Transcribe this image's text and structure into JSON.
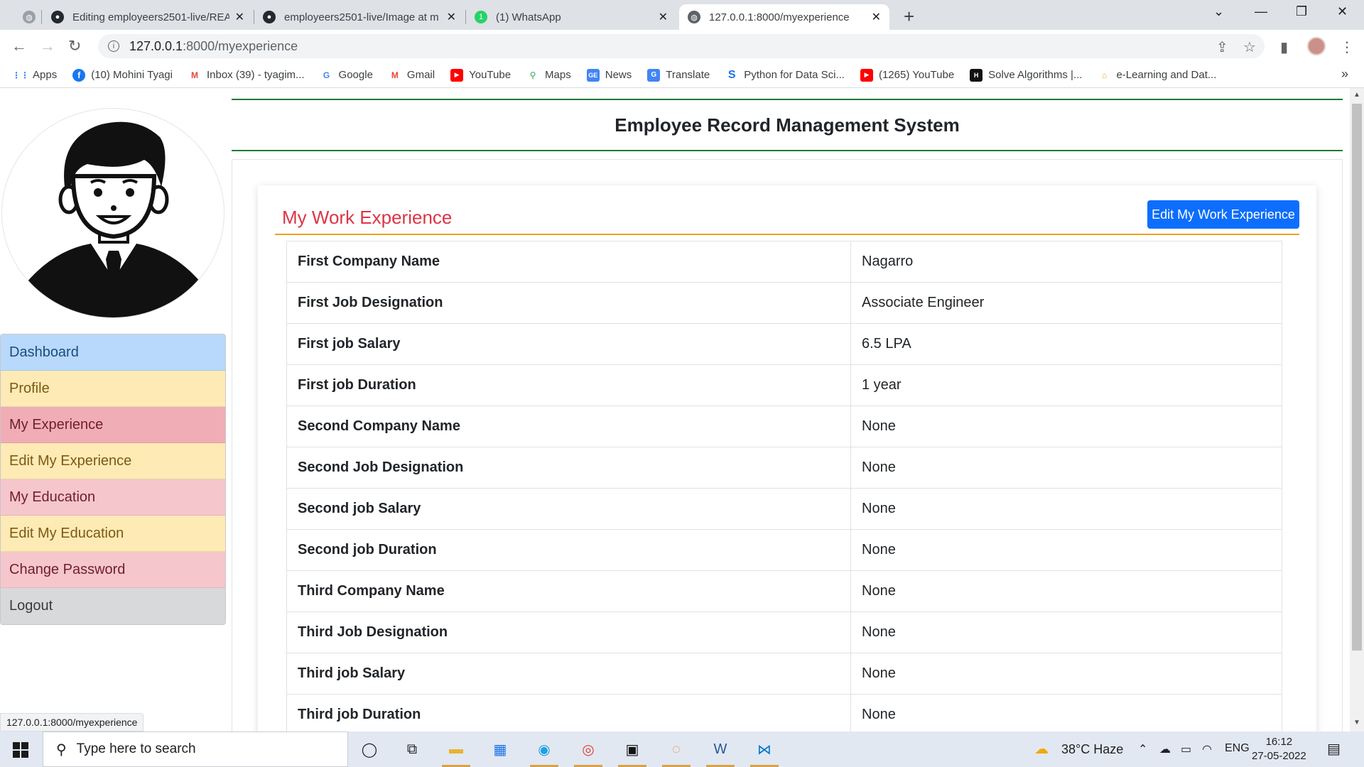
{
  "browser": {
    "tabs": [
      {
        "title": "",
        "favicon": "globe-icon"
      },
      {
        "title": "Editing employeers2501-live/REA",
        "favicon": "github-icon"
      },
      {
        "title": "employeers2501-live/Image at m",
        "favicon": "github-icon"
      },
      {
        "title": "(1) WhatsApp",
        "favicon": "whatsapp-icon"
      },
      {
        "title": "127.0.0.1:8000/myexperience",
        "favicon": "globe-icon",
        "active": true
      }
    ],
    "url_host": "127.0.0.1",
    "url_path": ":8000/myexperience",
    "bookmarks": [
      {
        "label": "Apps",
        "icon": "apps-grid-icon",
        "color": "#4285f4"
      },
      {
        "label": "(10) Mohini Tyagi",
        "icon": "facebook-icon",
        "color": "#1877f2"
      },
      {
        "label": "Inbox (39) - tyagim...",
        "icon": "gmail-icon",
        "color": "#ea4335"
      },
      {
        "label": "Google",
        "icon": "google-icon",
        "color": "#4285f4"
      },
      {
        "label": "Gmail",
        "icon": "gmail-icon",
        "color": "#ea4335"
      },
      {
        "label": "YouTube",
        "icon": "youtube-icon",
        "color": "#ff0000"
      },
      {
        "label": "Maps",
        "icon": "maps-icon",
        "color": "#34a853"
      },
      {
        "label": "News",
        "icon": "news-icon",
        "color": "#4285f4"
      },
      {
        "label": "Translate",
        "icon": "translate-icon",
        "color": "#4285f4"
      },
      {
        "label": "Python for Data Sci...",
        "icon": "scaler-icon",
        "color": "#1a73e8"
      },
      {
        "label": "(1265) YouTube",
        "icon": "youtube-icon",
        "color": "#ff0000"
      },
      {
        "label": "Solve Algorithms |...",
        "icon": "hackerrank-icon",
        "color": "#111111"
      },
      {
        "label": "e-Learning and Dat...",
        "icon": "elearning-icon",
        "color": "#e8a33d"
      }
    ],
    "status_url": "127.0.0.1:8000/myexperience"
  },
  "app": {
    "title": "Employee Record Management System",
    "menu": [
      {
        "label": "Dashboard",
        "color": "#b8d9fb"
      },
      {
        "label": "Profile",
        "color": "#fdeab5"
      },
      {
        "label": "My Experience",
        "color": "#f0adb6"
      },
      {
        "label": "Edit My Experience",
        "color": "#fdeab5"
      },
      {
        "label": "My Education",
        "color": "#f6c6cd"
      },
      {
        "label": "Edit My Education",
        "color": "#fdeab5"
      },
      {
        "label": "Change Password",
        "color": "#f6c6cd"
      },
      {
        "label": "Logout",
        "color": "#d8d9db"
      }
    ]
  },
  "experience": {
    "heading": "My Work Experience",
    "edit_button": "Edit My Work Experience",
    "rows": [
      {
        "label": "First Company Name",
        "value": "Nagarro"
      },
      {
        "label": "First Job Designation",
        "value": "Associate Engineer"
      },
      {
        "label": "First job Salary",
        "value": "6.5 LPA"
      },
      {
        "label": "First job Duration",
        "value": "1 year"
      },
      {
        "label": "Second Company Name",
        "value": "None"
      },
      {
        "label": "Second Job Designation",
        "value": "None"
      },
      {
        "label": "Second job Salary",
        "value": "None"
      },
      {
        "label": "Second job Duration",
        "value": "None"
      },
      {
        "label": "Third Company Name",
        "value": "None"
      },
      {
        "label": "Third Job Designation",
        "value": "None"
      },
      {
        "label": "Third job Salary",
        "value": "None"
      },
      {
        "label": "Third job Duration",
        "value": "None"
      }
    ]
  },
  "taskbar": {
    "search_placeholder": "Type here to search",
    "weather": "38°C  Haze",
    "language": "ENG",
    "time": "16:12",
    "date": "27-05-2022"
  }
}
